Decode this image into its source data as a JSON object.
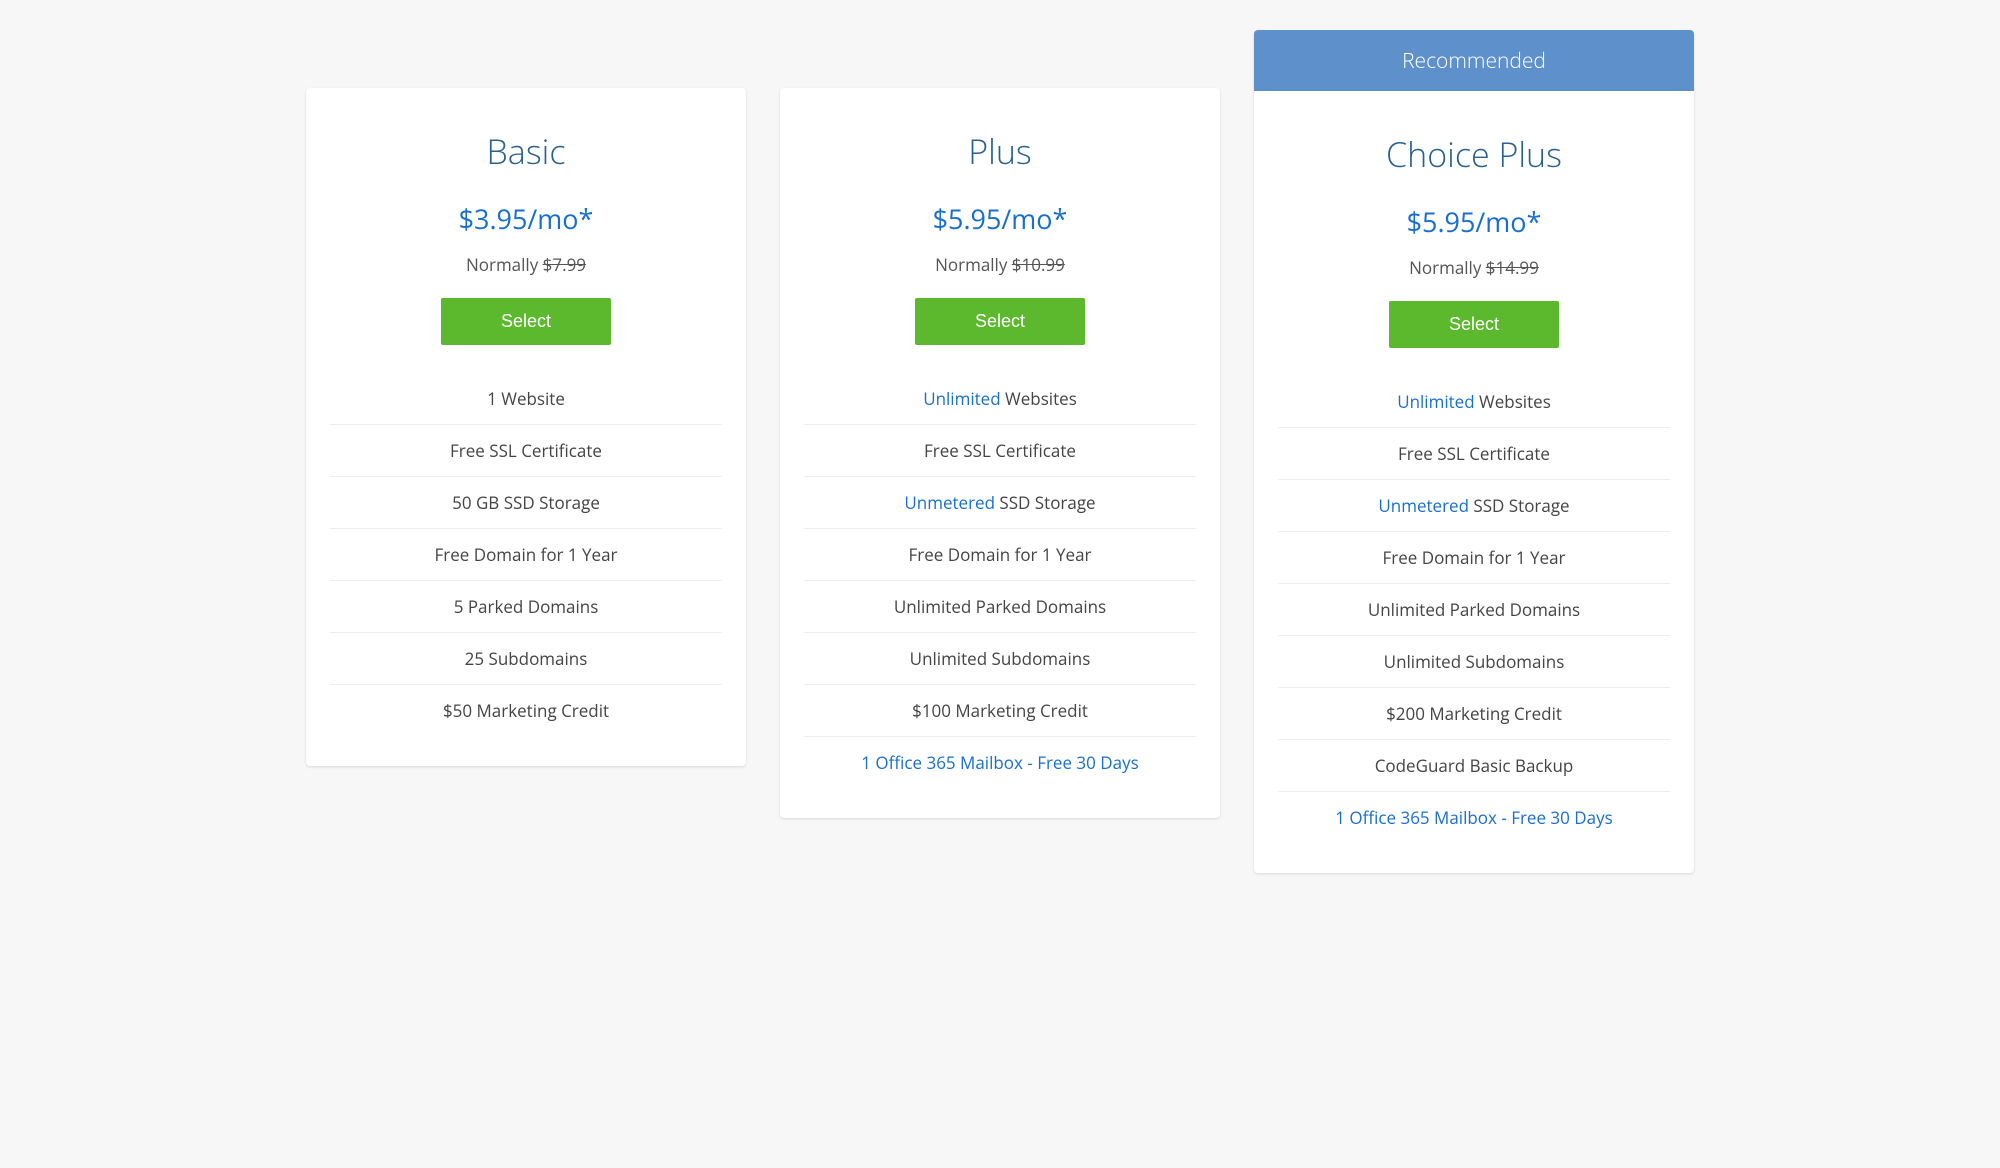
{
  "recommended_label": "Recommended",
  "normally_prefix": "Normally ",
  "select_label": "Select",
  "plans": [
    {
      "name": "Basic",
      "price": "$3.95/mo*",
      "normally": "$7.99",
      "recommended": false,
      "features": [
        {
          "text": "1 Website"
        },
        {
          "text": "Free SSL Certificate"
        },
        {
          "text": "50 GB SSD Storage"
        },
        {
          "text": "Free Domain for 1 Year"
        },
        {
          "text": "5 Parked Domains"
        },
        {
          "text": "25 Subdomains"
        },
        {
          "text": "$50 Marketing Credit"
        }
      ]
    },
    {
      "name": "Plus",
      "price": "$5.95/mo*",
      "normally": "$10.99",
      "recommended": false,
      "features": [
        {
          "prefix": "Unlimited",
          "rest": " Websites",
          "prefix_highlight": true
        },
        {
          "text": "Free SSL Certificate"
        },
        {
          "prefix": "Unmetered",
          "rest": " SSD Storage",
          "prefix_highlight": true
        },
        {
          "text": "Free Domain for 1 Year"
        },
        {
          "text": "Unlimited Parked Domains"
        },
        {
          "text": "Unlimited Subdomains"
        },
        {
          "text": "$100 Marketing Credit"
        },
        {
          "text": "1 Office 365 Mailbox - Free 30 Days",
          "highlight": true
        }
      ]
    },
    {
      "name": "Choice Plus",
      "price": "$5.95/mo*",
      "normally": "$14.99",
      "recommended": true,
      "features": [
        {
          "prefix": "Unlimited",
          "rest": " Websites",
          "prefix_highlight": true
        },
        {
          "text": "Free SSL Certificate"
        },
        {
          "prefix": "Unmetered",
          "rest": " SSD Storage",
          "prefix_highlight": true
        },
        {
          "text": "Free Domain for 1 Year"
        },
        {
          "text": "Unlimited Parked Domains"
        },
        {
          "text": "Unlimited Subdomains"
        },
        {
          "text": "$200 Marketing Credit"
        },
        {
          "text": "CodeGuard Basic Backup"
        },
        {
          "text": "1 Office 365 Mailbox - Free 30 Days",
          "highlight": true
        }
      ]
    }
  ]
}
